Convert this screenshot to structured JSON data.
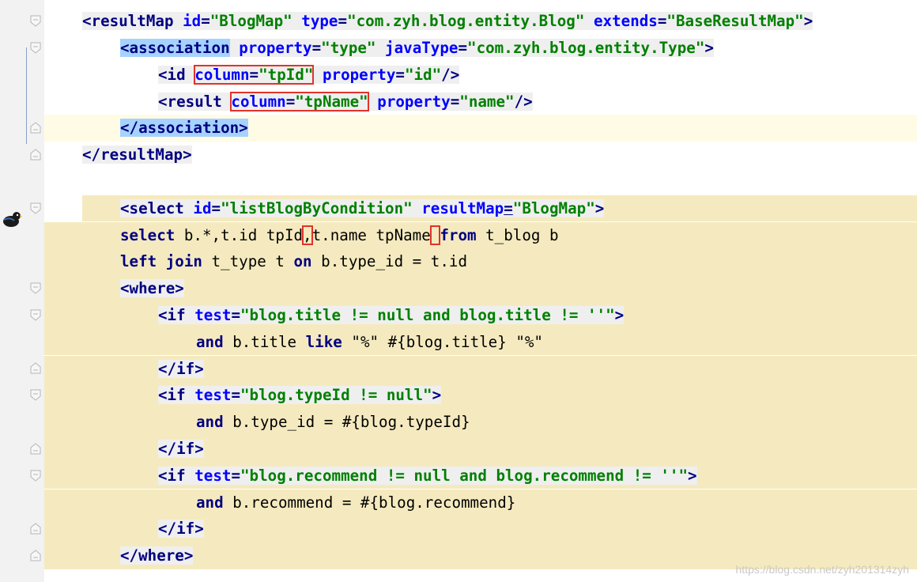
{
  "editor": {
    "lines": [
      {
        "segments": [
          [
            "tag",
            "<resultMap "
          ],
          [
            "attr",
            "id"
          ],
          [
            "tag",
            "="
          ],
          [
            "str",
            "\"BlogMap\""
          ],
          [
            "tag",
            " "
          ],
          [
            "attr",
            "type"
          ],
          [
            "tag",
            "="
          ],
          [
            "str",
            "\"com.zyh.blog.entity.Blog\""
          ],
          [
            "tag",
            " "
          ],
          [
            "attr",
            "extends"
          ],
          [
            "tag",
            "="
          ],
          [
            "str",
            "\"BaseResultMap\""
          ],
          [
            "tag",
            ">"
          ]
        ]
      },
      {
        "segments": [
          [
            "tag",
            "<association"
          ],
          [
            "tag",
            " "
          ],
          [
            "attr",
            "property"
          ],
          [
            "tag",
            "="
          ],
          [
            "str",
            "\"type\""
          ],
          [
            "tag",
            " "
          ],
          [
            "attr",
            "javaType"
          ],
          [
            "tag",
            "="
          ],
          [
            "str",
            "\"com.zyh.blog.entity.Type\""
          ],
          [
            "tag",
            ">"
          ]
        ]
      },
      {
        "segments": [
          [
            "tag",
            "<id "
          ],
          [
            "attr",
            "column"
          ],
          [
            "tag",
            "="
          ],
          [
            "str",
            "\"tpId\""
          ],
          [
            "tag",
            " "
          ],
          [
            "attr",
            "property"
          ],
          [
            "tag",
            "="
          ],
          [
            "str",
            "\"id\""
          ],
          [
            "tag",
            "/>"
          ]
        ]
      },
      {
        "segments": [
          [
            "tag",
            "<result "
          ],
          [
            "attr",
            "column"
          ],
          [
            "tag",
            "="
          ],
          [
            "str",
            "\"tpName\""
          ],
          [
            "tag",
            " "
          ],
          [
            "attr",
            "property"
          ],
          [
            "tag",
            "="
          ],
          [
            "str",
            "\"name\""
          ],
          [
            "tag",
            "/>"
          ]
        ]
      },
      {
        "segments": [
          [
            "tag",
            "</association>"
          ]
        ]
      },
      {
        "segments": [
          [
            "tag",
            "</resultMap>"
          ]
        ]
      },
      {
        "segments": []
      },
      {
        "segments": [
          [
            "tag",
            "<select "
          ],
          [
            "attr",
            "id"
          ],
          [
            "tag",
            "="
          ],
          [
            "str",
            "\"listBlogByCondition\""
          ],
          [
            "tag",
            " "
          ],
          [
            "attr",
            "resultMap"
          ],
          [
            "tag",
            "="
          ],
          [
            "str",
            "\"BlogMap\""
          ],
          [
            "tag",
            ">"
          ]
        ]
      },
      {
        "segments": [
          [
            "sql",
            "select"
          ],
          [
            "plain",
            " b.*,"
          ],
          [
            "plain",
            "t.id tpId"
          ],
          [
            "plain",
            ","
          ],
          [
            "plain",
            "t.name tpName"
          ],
          [
            "plain",
            " "
          ],
          [
            "sql",
            "from"
          ],
          [
            "plain",
            " t_blog b"
          ]
        ]
      },
      {
        "segments": [
          [
            "sql",
            "left join"
          ],
          [
            "plain",
            " t_type t "
          ],
          [
            "sql",
            "on"
          ],
          [
            "plain",
            " b.type_id = t.id"
          ]
        ]
      },
      {
        "segments": [
          [
            "tag",
            "<where>"
          ]
        ]
      },
      {
        "segments": [
          [
            "tag",
            "<if "
          ],
          [
            "attr",
            "test"
          ],
          [
            "tag",
            "="
          ],
          [
            "str",
            "\"blog.title != null and blog.title != ''\""
          ],
          [
            "tag",
            ">"
          ]
        ]
      },
      {
        "segments": [
          [
            "sql",
            "and"
          ],
          [
            "plain",
            " b.title "
          ],
          [
            "sql",
            "like"
          ],
          [
            "plain",
            " \"%\" #{blog.title} \"%\""
          ]
        ]
      },
      {
        "segments": [
          [
            "tag",
            "</if>"
          ]
        ]
      },
      {
        "segments": [
          [
            "tag",
            "<if "
          ],
          [
            "attr",
            "test"
          ],
          [
            "tag",
            "="
          ],
          [
            "str",
            "\"blog.typeId != null\""
          ],
          [
            "tag",
            ">"
          ]
        ]
      },
      {
        "segments": [
          [
            "sql",
            "and"
          ],
          [
            "plain",
            " b.type_id = #{blog.typeId}"
          ]
        ]
      },
      {
        "segments": [
          [
            "tag",
            "</if>"
          ]
        ]
      },
      {
        "segments": [
          [
            "tag",
            "<if "
          ],
          [
            "attr",
            "test"
          ],
          [
            "tag",
            "="
          ],
          [
            "str",
            "\"blog.recommend != null and blog.recommend != ''\""
          ],
          [
            "tag",
            ">"
          ]
        ]
      },
      {
        "segments": [
          [
            "sql",
            "and"
          ],
          [
            "plain",
            " b.recommend = #{blog.recommend}"
          ]
        ]
      },
      {
        "segments": [
          [
            "tag",
            "</if>"
          ]
        ]
      },
      {
        "segments": [
          [
            "tag",
            "</where>"
          ]
        ]
      }
    ]
  },
  "watermark": "https://blog.csdn.net/zyh201314zyh",
  "colors": {
    "tag": "#000080",
    "attr": "#0000ff",
    "string": "#008000",
    "condition_block_bg": "#f5eabf",
    "current_line_bg": "#fffbe5",
    "match_highlight": "#a6d2ff",
    "annotation_box": "#e0332b"
  },
  "icons": {
    "bird": "bird-icon",
    "fold": "fold-marker-icon"
  }
}
